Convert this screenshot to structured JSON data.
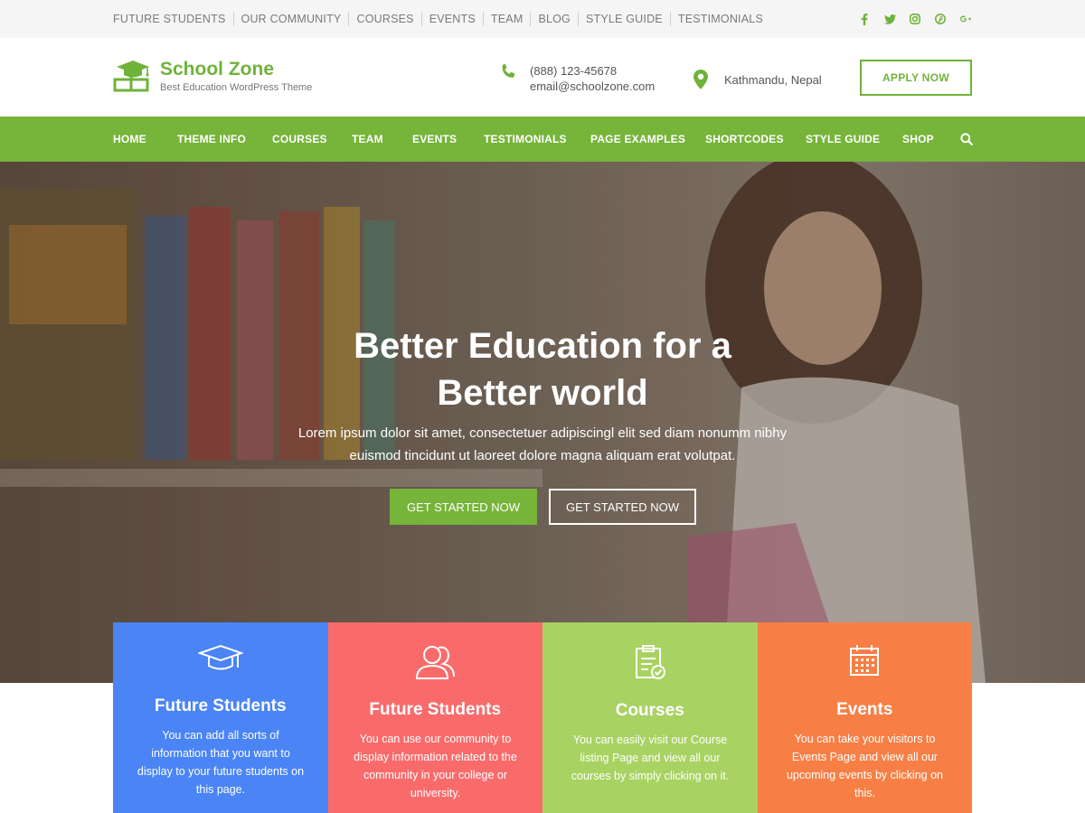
{
  "topbar": {
    "links": [
      "FUTURE STUDENTS",
      "OUR COMMUNITY",
      "COURSES",
      "EVENTS",
      "TEAM",
      "BLOG",
      "STYLE GUIDE",
      "TESTIMONIALS"
    ],
    "social_icons": [
      "facebook-icon",
      "twitter-icon",
      "instagram-icon",
      "pinterest-icon",
      "google-plus-icon"
    ]
  },
  "header": {
    "brand_name": "School Zone",
    "tagline": "Best Education WordPress Theme",
    "phone": "(888) 123-45678",
    "email": "email@schoolzone.com",
    "location": "Kathmandu, Nepal",
    "apply_label": "APPLY NOW"
  },
  "nav": {
    "items": [
      "HOME",
      "THEME INFO",
      "COURSES",
      "TEAM",
      "EVENTS",
      "TESTIMONIALS",
      "PAGE EXAMPLES",
      "SHORTCODES",
      "STYLE GUIDE",
      "SHOP"
    ]
  },
  "hero": {
    "title_line1": "Better Education for a",
    "title_line2": "Better world",
    "subtitle_line1": "Lorem ipsum dolor sit amet, consectetuer adipiscingl elit sed diam nonumm nibhy",
    "subtitle_line2": "euismod tincidunt ut laoreet dolore magna aliquam erat volutpat.",
    "primary_button": "GET STARTED NOW",
    "secondary_button": "GET STARTED NOW"
  },
  "features": [
    {
      "title": "Future Students",
      "text": "You can add all sorts of information that you want to display to your future students on this page.",
      "color": "#4a84f5",
      "icon": "graduation-cap-icon"
    },
    {
      "title": "Future Students",
      "text": "You can use our community to display information related to the community in your college or university.",
      "color": "#f96b6b",
      "icon": "users-icon"
    },
    {
      "title": "Courses",
      "text": "You can easily visit our Course listing Page and view all our courses by simply clicking on it.",
      "color": "#a8d262",
      "icon": "clipboard-check-icon"
    },
    {
      "title": "Events",
      "text": "You can take your visitors to Events Page and view all our upcoming events by clicking on this.",
      "color": "#f77f45",
      "icon": "calendar-icon"
    }
  ],
  "colors": {
    "brand_green": "#76b43a",
    "topbar_bg": "#f5f5f5"
  }
}
